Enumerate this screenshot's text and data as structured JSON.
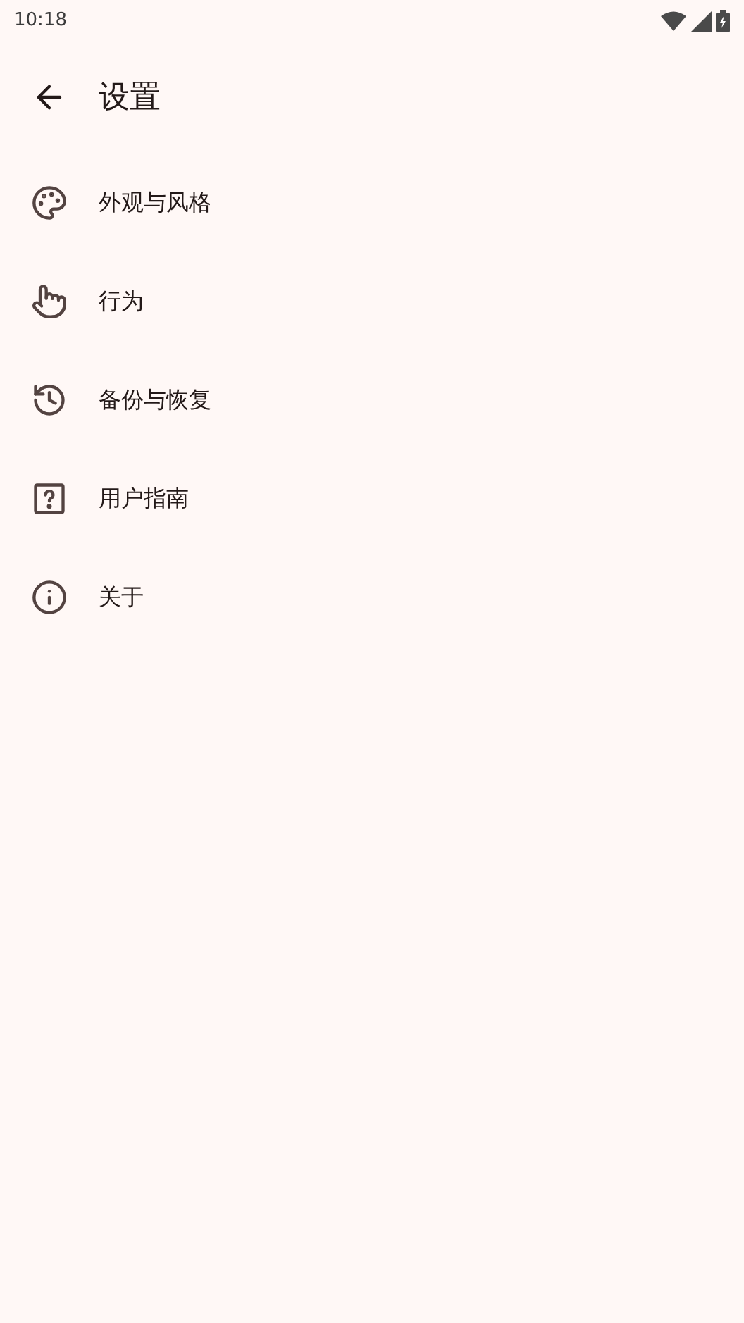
{
  "status_bar": {
    "time": "10:18"
  },
  "app_bar": {
    "title": "设置"
  },
  "items": [
    {
      "kind": "palette",
      "label": "外观与风格"
    },
    {
      "kind": "touch",
      "label": "行为"
    },
    {
      "kind": "history",
      "label": "备份与恢复"
    },
    {
      "kind": "help",
      "label": "用户指南"
    },
    {
      "kind": "info",
      "label": "关于"
    }
  ]
}
